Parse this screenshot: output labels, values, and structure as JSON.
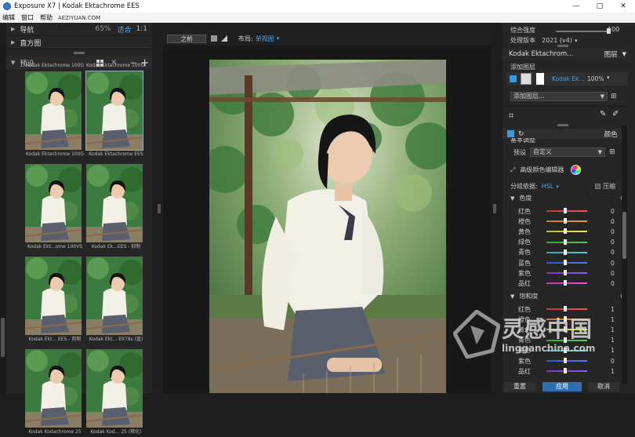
{
  "window": {
    "title": "Exposure X7 | Kodak Ektachrome EES",
    "minimize": "—",
    "maximize": "□",
    "close": "✕"
  },
  "menu": {
    "items": [
      "编辑",
      "窗口",
      "帮助"
    ],
    "watermark": "AEZIYUAN.COM"
  },
  "left": {
    "navigation": {
      "label": "导航",
      "zoom": "65%",
      "fit": "适合",
      "one": "1:1"
    },
    "histogram": {
      "label": "直方图"
    },
    "presets": {
      "label": "预设"
    },
    "thumbs": [
      {
        "label": "Kodak Ektachrome 100G",
        "top_label": "Kodak Ektachrome 100G"
      },
      {
        "label": "Kodak Ektachrome EES",
        "top_label": "Kodak Ektachrome 100GX"
      },
      {
        "label": "Kodak Ekt...ome 100VS"
      },
      {
        "label": "Kodak Ek...EES - 抑制"
      },
      {
        "label": "Kodak Ekt... EES - 剪制"
      },
      {
        "label": "Kodak Ekt... E978s (蓝)"
      },
      {
        "label": "Kodak Kodachrome 25"
      },
      {
        "label": "Kodak Kod... 25 (稀化)"
      }
    ]
  },
  "center": {
    "before_btn": "之前",
    "layout_label": "布局:",
    "layout_value": "单视图"
  },
  "right": {
    "overall_strength": {
      "label": "综合强度",
      "value": "100",
      "level": 0.95
    },
    "process_version": {
      "label": "处理版本",
      "value": "2021 (v4)"
    },
    "preset_name": "Kodak Ektachrom...",
    "layers_tab": "图层",
    "add_layer": "添加图层",
    "layer_item": {
      "name": "Kodak Ek...",
      "opacity": "100%"
    },
    "add_layer_dropdown": "添加图层...",
    "color_tab": "颜色",
    "basic_adjust": "基本调整",
    "preset_label": "预设",
    "preset_value": "自定义",
    "advanced_editor": "高级颜色编辑器",
    "group_by_label": "分组依据:",
    "group_by_value": "HSL",
    "compress": "压缩",
    "hue_section": "色度",
    "hue_rows": [
      {
        "name": "红色",
        "value": "0"
      },
      {
        "name": "橙色",
        "value": "0"
      },
      {
        "name": "黄色",
        "value": "0"
      },
      {
        "name": "绿色",
        "value": "0"
      },
      {
        "name": "青色",
        "value": "0"
      },
      {
        "name": "蓝色",
        "value": "0"
      },
      {
        "name": "紫色",
        "value": "0"
      },
      {
        "name": "品红",
        "value": "0"
      }
    ],
    "sat_section": "饱和度",
    "sat_rows": [
      {
        "name": "红色",
        "value": "1"
      },
      {
        "name": "橙色",
        "value": "1"
      },
      {
        "name": "黄色",
        "value": "1"
      },
      {
        "name": "青色",
        "value": "1"
      },
      {
        "name": "紫色",
        "value": "1"
      },
      {
        "name": "紫色",
        "value": "0"
      },
      {
        "name": "品红",
        "value": "1"
      }
    ],
    "reset_btn": "重置",
    "apply_btn": "应用",
    "cancel_btn": "取消"
  },
  "watermark": {
    "cn": "灵感中国",
    "en": "lingganchina.com"
  },
  "colors": {
    "accent": "#4aa3e8",
    "apply": "#2f6fae"
  }
}
